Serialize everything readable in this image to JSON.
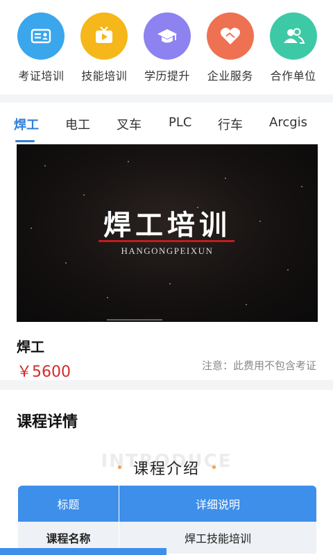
{
  "categories": [
    {
      "label": "考证培训",
      "icon": "id-card-icon",
      "color": "#3aa6ec"
    },
    {
      "label": "技能培训",
      "icon": "tv-play-icon",
      "color": "#f5b719"
    },
    {
      "label": "学历提升",
      "icon": "graduation-cap-icon",
      "color": "#8c82f0"
    },
    {
      "label": "企业服务",
      "icon": "handshake-heart-icon",
      "color": "#ee7152"
    },
    {
      "label": "合作单位",
      "icon": "people-icon",
      "color": "#3ec9a6"
    }
  ],
  "tabs": [
    {
      "label": "焊工",
      "active": true
    },
    {
      "label": "电工",
      "active": false
    },
    {
      "label": "叉车",
      "active": false
    },
    {
      "label": "PLC",
      "active": false
    },
    {
      "label": "行车",
      "active": false
    },
    {
      "label": "Arcgis",
      "active": false
    }
  ],
  "video": {
    "title": "焊工培训",
    "subtitle": "HANGONGPEIXUN"
  },
  "course": {
    "name": "焊工",
    "price": "￥5600",
    "note": "注意：此费用不包含考证"
  },
  "details": {
    "heading": "课程详情",
    "intro_title": "课程介绍",
    "intro_ghost": "INTRODUCE",
    "table_headers": [
      "标题",
      "详细说明"
    ],
    "rows": [
      [
        "课程名称",
        "焊工技能培训"
      ]
    ]
  },
  "colors": {
    "accent": "#2f7fd9",
    "table_header": "#3d8fea",
    "price": "#d42a2a"
  }
}
